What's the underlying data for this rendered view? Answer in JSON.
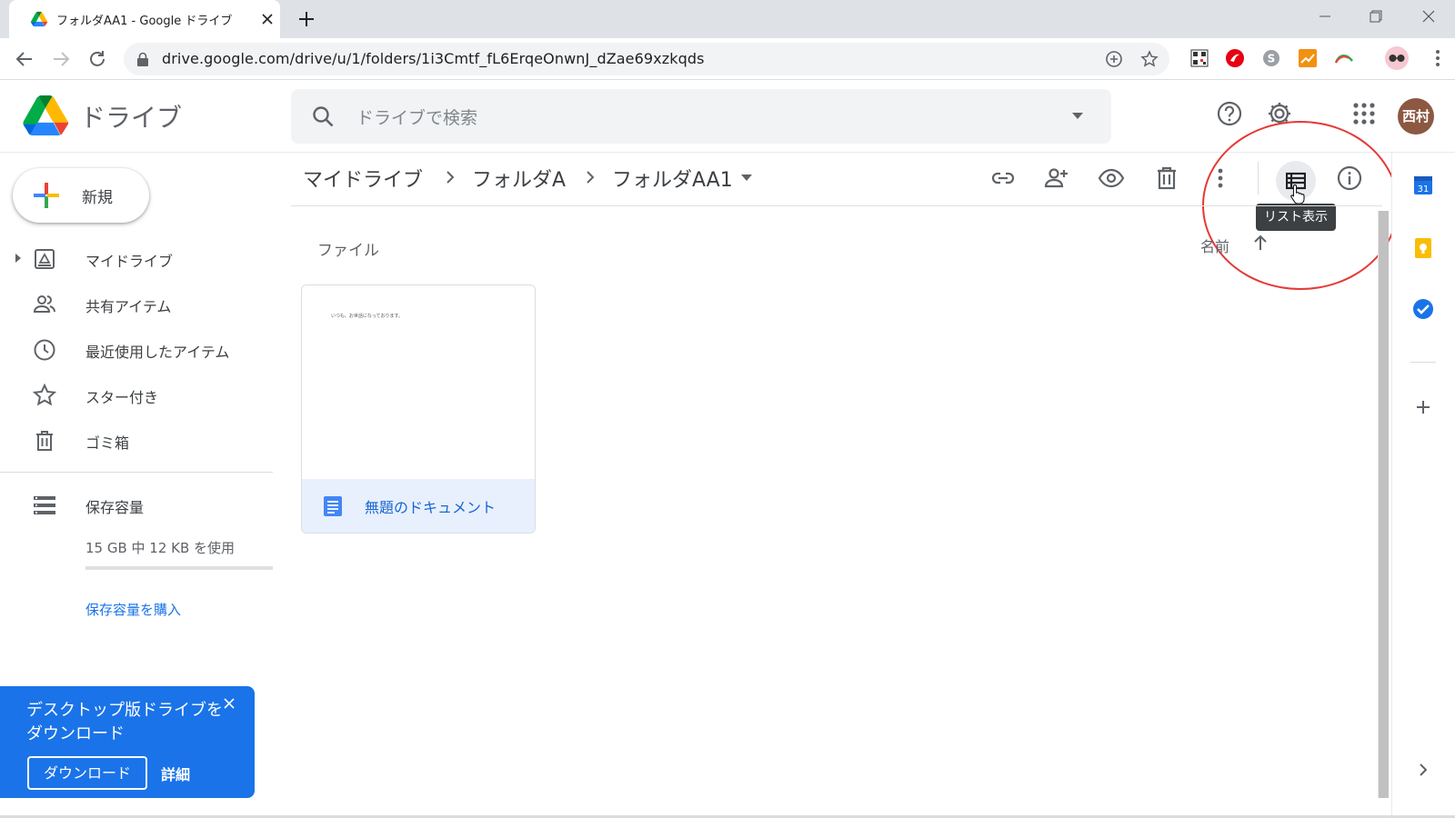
{
  "browser": {
    "tab_title": "フォルダAA1 - Google ドライブ",
    "url": "drive.google.com/drive/u/1/folders/1i3Cmtf_fL6ErqeOnwnJ_dZae69xzkqds"
  },
  "header": {
    "app_name": "ドライブ",
    "search_placeholder": "ドライブで検索",
    "avatar_text": "西村"
  },
  "sidebar": {
    "new_label": "新規",
    "items": [
      {
        "label": "マイドライブ",
        "icon": "my-drive-icon"
      },
      {
        "label": "共有アイテム",
        "icon": "shared-icon"
      },
      {
        "label": "最近使用したアイテム",
        "icon": "recent-icon"
      },
      {
        "label": "スター付き",
        "icon": "star-icon"
      },
      {
        "label": "ゴミ箱",
        "icon": "trash-icon"
      }
    ],
    "storage_label": "保存容量",
    "storage_usage": "15 GB 中 12 KB を使用",
    "storage_fraction": 1e-06,
    "buy_storage": "保存容量を購入"
  },
  "banner": {
    "text": "デスクトップ版ドライブをダウンロード",
    "download_button": "ダウンロード",
    "details": "詳細"
  },
  "main": {
    "breadcrumb": [
      "マイドライブ",
      "フォルダA",
      "フォルダAA1"
    ],
    "tooltip": "リスト表示",
    "files_section": "ファイル",
    "sort_label": "名前",
    "files": [
      {
        "name": "無題のドキュメント",
        "preview": "いつも、お世話になっております。"
      }
    ]
  },
  "side_panel": {
    "calendar_day": "31"
  },
  "colors": {
    "accent": "#1a73e8",
    "annotation": "#e53935",
    "avatar": "#8d5842"
  }
}
